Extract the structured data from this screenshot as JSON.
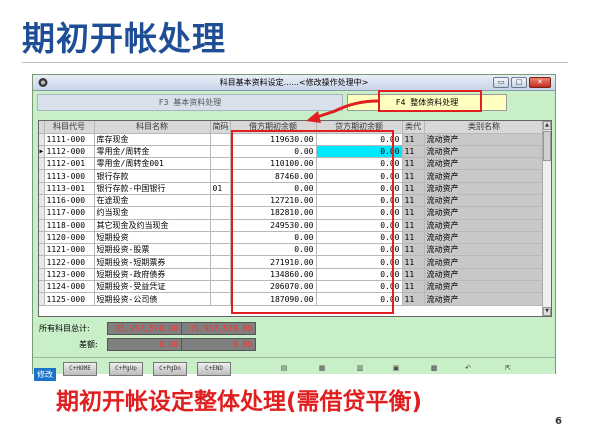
{
  "slide": {
    "title": "期初开帐处理",
    "caption": "期初开帐设定整体处理(需借贷平衡)",
    "page_number": "6"
  },
  "window": {
    "title": "科目基本资料设定......<修改操作处理中>",
    "min_label": "▭",
    "max_label": "□",
    "close_label": "✕"
  },
  "tabs": {
    "f3": "F3 基本资料处理",
    "f4": "F4 整体资料处理"
  },
  "grid": {
    "columns": [
      "科目代号",
      "科目名称",
      "简码",
      "借方期初余额",
      "贷方期初余额",
      "类代",
      "类别名称"
    ],
    "rows": [
      {
        "code": "1111-000",
        "name": "库存现金",
        "short": "",
        "debit": "119630.00",
        "credit": "0.00",
        "cat": "11",
        "catname": "流动资产",
        "current": false
      },
      {
        "code": "1112-000",
        "name": "零用金/周转金",
        "short": "",
        "debit": "0.00",
        "credit": "0.00",
        "cat": "11",
        "catname": "流动资产",
        "current": true
      },
      {
        "code": "1112-001",
        "name": "零用金/周转金001",
        "short": "",
        "debit": "110100.00",
        "credit": "0.00",
        "cat": "11",
        "catname": "流动资产",
        "current": false
      },
      {
        "code": "1113-000",
        "name": "银行存款",
        "short": "",
        "debit": "87460.00",
        "credit": "0.00",
        "cat": "11",
        "catname": "流动资产",
        "current": false
      },
      {
        "code": "1113-001",
        "name": "银行存款-中国银行",
        "short": "01",
        "debit": "0.00",
        "credit": "0.00",
        "cat": "11",
        "catname": "流动资产",
        "current": false
      },
      {
        "code": "1116-000",
        "name": "在途现金",
        "short": "",
        "debit": "127210.00",
        "credit": "0.00",
        "cat": "11",
        "catname": "流动资产",
        "current": false
      },
      {
        "code": "1117-000",
        "name": "约当现金",
        "short": "",
        "debit": "182810.00",
        "credit": "0.00",
        "cat": "11",
        "catname": "流动资产",
        "current": false
      },
      {
        "code": "1118-000",
        "name": "其它现金及约当现金",
        "short": "",
        "debit": "249530.00",
        "credit": "0.00",
        "cat": "11",
        "catname": "流动资产",
        "current": false
      },
      {
        "code": "1120-000",
        "name": "短期投资",
        "short": "",
        "debit": "0.00",
        "credit": "0.00",
        "cat": "11",
        "catname": "流动资产",
        "current": false
      },
      {
        "code": "1121-000",
        "name": "短期投资-股票",
        "short": "",
        "debit": "0.00",
        "credit": "0.00",
        "cat": "11",
        "catname": "流动资产",
        "current": false
      },
      {
        "code": "1122-000",
        "name": "短期投资-短期票券",
        "short": "",
        "debit": "271910.00",
        "credit": "0.00",
        "cat": "11",
        "catname": "流动资产",
        "current": false
      },
      {
        "code": "1123-000",
        "name": "短期投资-政府债券",
        "short": "",
        "debit": "134860.00",
        "credit": "0.00",
        "cat": "11",
        "catname": "流动资产",
        "current": false
      },
      {
        "code": "1124-000",
        "name": "短期投资-受益凭证",
        "short": "",
        "debit": "206070.00",
        "credit": "0.00",
        "cat": "11",
        "catname": "流动资产",
        "current": false
      },
      {
        "code": "1125-000",
        "name": "短期投资-公司债",
        "short": "",
        "debit": "187090.00",
        "credit": "0.00",
        "cat": "11",
        "catname": "流动资产",
        "current": false
      }
    ]
  },
  "totals": {
    "all_label": "所有科目总计:",
    "debit_total": "35,957,570.00",
    "credit_total": "35,957,570.00",
    "diff_label": "差额:",
    "debit_diff": "0.00",
    "credit_diff": "0.00"
  },
  "toolbar": {
    "mode": "修改",
    "btn1": "C+HOME",
    "btn2": "C+PgUp",
    "btn3": "C+PgDn",
    "btn4": "C+END"
  },
  "colors": {
    "title": "#1f4e96",
    "annotation": "#e02020",
    "window_bg": "#c9efc9",
    "selected_cell": "#00e8ff"
  }
}
